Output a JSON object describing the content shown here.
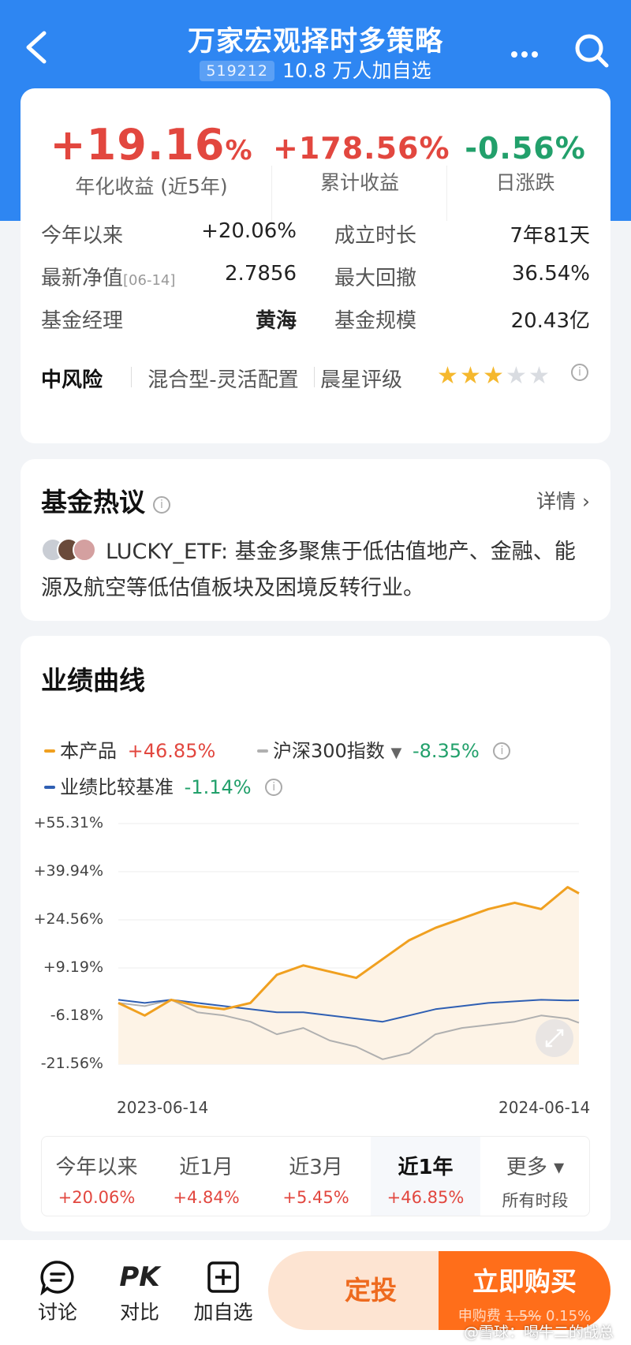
{
  "header": {
    "title": "万家宏观择时多策略",
    "code": "519212",
    "followers": "10.8 万人加自选"
  },
  "summary": {
    "annual_return": "+19.16",
    "annual_return_unit": "%",
    "annual_return_label": "年化收益 (近5年)",
    "cumulative_return": "+178.56%",
    "cumulative_return_label": "累计收益",
    "daily_change": "-0.56%",
    "daily_change_label": "日涨跌"
  },
  "details": {
    "ytd_label": "今年以来",
    "ytd_value": "+20.06%",
    "age_label": "成立时长",
    "age_value": "7年81天",
    "nav_label": "最新净值",
    "nav_date": "[06-14]",
    "nav_value": "2.7856",
    "drawdown_label": "最大回撤",
    "drawdown_value": "36.54%",
    "manager_label": "基金经理",
    "manager_value": "黄海",
    "size_label": "基金规模",
    "size_value": "20.43亿"
  },
  "risk": {
    "level": "中风险",
    "type": "混合型-灵活配置",
    "rating_label": "晨星评级",
    "rating_stars": 3,
    "rating_max": 5,
    "colors": {
      "star_on": "#f5b82e",
      "star_off": "#d9dce1"
    }
  },
  "discussion": {
    "title": "基金热议",
    "detail_link": "详情",
    "comment": "LUCKY_ETF: 基金多聚焦于低估值地产、金融、能源及航空等低估值板块及困境反转行业。"
  },
  "performance": {
    "title": "业绩曲线",
    "legend": {
      "product_name": "本产品",
      "product_value": "+46.85%",
      "index_name": "沪深300指数",
      "index_value": "-8.35%",
      "benchmark_name": "业绩比较基准",
      "benchmark_value": "-1.14%"
    },
    "periods": [
      {
        "name": "今年以来",
        "pct": "+20.06%"
      },
      {
        "name": "近1月",
        "pct": "+4.84%"
      },
      {
        "name": "近3月",
        "pct": "+5.45%"
      },
      {
        "name": "近1年",
        "pct": "+46.85%",
        "active": true
      },
      {
        "name": "更多 ▾",
        "pct": "所有时段"
      }
    ]
  },
  "chart_data": {
    "type": "line",
    "x_range": [
      "2023-06-14",
      "2024-06-14"
    ],
    "tick_x": [
      "2023-06-14",
      "2024-06-14"
    ],
    "tick_y": [
      "+55.31%",
      "+39.94%",
      "+24.56%",
      "+9.19%",
      "-6.18%",
      "-21.56%"
    ],
    "ylim": [
      -21.56,
      55.31
    ],
    "grid": true,
    "series": [
      {
        "name": "本产品",
        "color": "#f0a020",
        "x": [
          "2023-06-14",
          "2023-07-05",
          "2023-07-26",
          "2023-08-16",
          "2023-09-06",
          "2023-09-27",
          "2023-10-18",
          "2023-11-08",
          "2023-11-29",
          "2023-12-20",
          "2024-01-10",
          "2024-01-31",
          "2024-02-21",
          "2024-03-13",
          "2024-04-03",
          "2024-04-24",
          "2024-05-15",
          "2024-06-05",
          "2024-06-14"
        ],
        "values": [
          -2.0,
          -6.0,
          -1.0,
          -3.0,
          -4.0,
          -2.0,
          7.0,
          10.0,
          8.0,
          6.0,
          12.0,
          18.0,
          22.0,
          25.0,
          28.0,
          30.0,
          28.0,
          35.0,
          33.0
        ]
      },
      {
        "name": "沪深300指数",
        "color": "#b0b0b0",
        "x": [
          "2023-06-14",
          "2023-07-05",
          "2023-07-26",
          "2023-08-16",
          "2023-09-06",
          "2023-09-27",
          "2023-10-18",
          "2023-11-08",
          "2023-11-29",
          "2023-12-20",
          "2024-01-10",
          "2024-01-31",
          "2024-02-21",
          "2024-03-13",
          "2024-04-03",
          "2024-04-24",
          "2024-05-15",
          "2024-06-05",
          "2024-06-14"
        ],
        "values": [
          -2.0,
          -3.0,
          -1.0,
          -5.0,
          -6.0,
          -8.0,
          -12.0,
          -10.0,
          -14.0,
          -16.0,
          -20.0,
          -18.0,
          -12.0,
          -10.0,
          -9.0,
          -8.0,
          -6.0,
          -7.0,
          -8.35
        ]
      },
      {
        "name": "业绩比较基准",
        "color": "#2f5fb3",
        "x": [
          "2023-06-14",
          "2023-07-05",
          "2023-07-26",
          "2023-08-16",
          "2023-09-06",
          "2023-09-27",
          "2023-10-18",
          "2023-11-08",
          "2023-11-29",
          "2023-12-20",
          "2024-01-10",
          "2024-01-31",
          "2024-02-21",
          "2024-03-13",
          "2024-04-03",
          "2024-04-24",
          "2024-05-15",
          "2024-06-05",
          "2024-06-14"
        ],
        "values": [
          -1.0,
          -2.0,
          -1.0,
          -2.0,
          -3.0,
          -4.0,
          -5.0,
          -5.0,
          -6.0,
          -7.0,
          -8.0,
          -6.0,
          -4.0,
          -3.0,
          -2.0,
          -1.5,
          -1.0,
          -1.2,
          -1.14
        ]
      }
    ]
  },
  "bottombar": {
    "discuss": "讨论",
    "compare": "对比",
    "compare_icon_text": "PK",
    "watchlist": "加自选",
    "plan": "定投",
    "buy": "立即购买",
    "fee_label": "申购费",
    "fee_original": "1.5%",
    "fee_current": "0.15%"
  },
  "watermark": "@雪球：喝牛二的战总"
}
